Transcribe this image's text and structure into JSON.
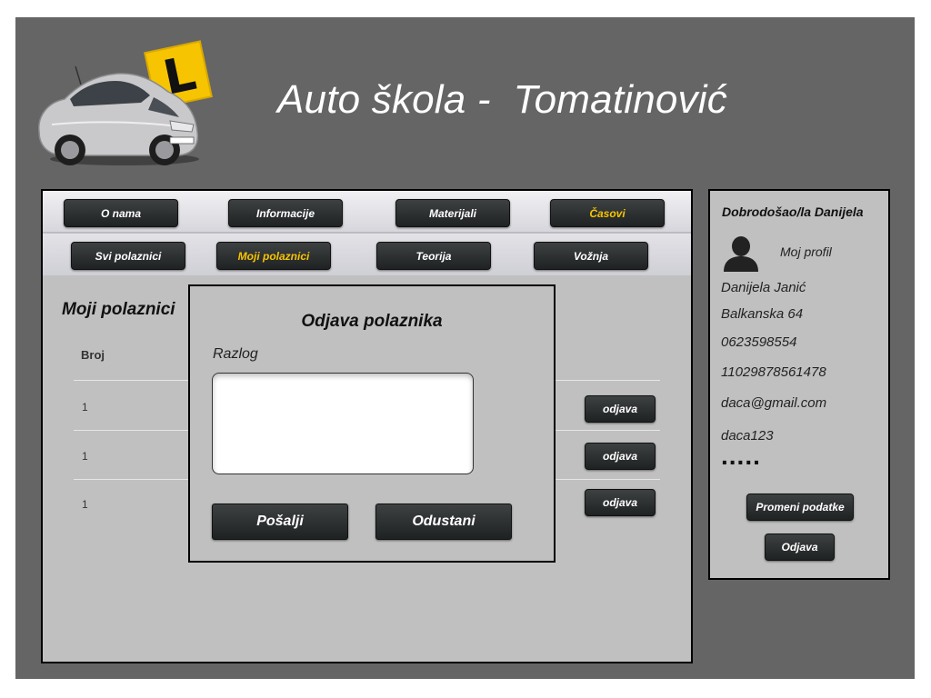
{
  "header": {
    "title": "Auto škola -  Tomatinović",
    "logo_plate": "L",
    "logo_icon": "car-with-l-sign-logo"
  },
  "nav": {
    "main": [
      {
        "label": "O nama",
        "active": false
      },
      {
        "label": "Informacije",
        "active": false
      },
      {
        "label": "Materijali",
        "active": false
      },
      {
        "label": "Časovi",
        "active": true
      }
    ],
    "sub": [
      {
        "label": "Svi polaznici",
        "active": false
      },
      {
        "label": "Moji polaznici",
        "active": true
      },
      {
        "label": "Teorija",
        "active": false
      },
      {
        "label": "Vožnja",
        "active": false
      }
    ]
  },
  "students": {
    "title": "Moji polaznici",
    "columns": [
      "Broj"
    ],
    "rows": [
      {
        "broj": "1",
        "action": "odjava"
      },
      {
        "broj": "1",
        "action": "odjava"
      },
      {
        "broj": "1",
        "action": "odjava"
      }
    ]
  },
  "modal": {
    "title": "Odjava polaznika",
    "reason_label": "Razlog",
    "reason_value": "",
    "submit_label": "Pošalji",
    "cancel_label": "Odustani"
  },
  "user": {
    "welcome": "Dobrodošao/la Danijela",
    "avatar_icon": "user-silhouette-icon",
    "profile_link": "Moj profil",
    "name": "Danijela Janić",
    "address": "Balkanska 64",
    "phone": "0623598554",
    "jmbg": "11029878561478",
    "email": "daca@gmail.com",
    "username": "daca123",
    "password_masked": ".....",
    "edit_label": "Promeni podatke",
    "logout_label": "Odjava"
  },
  "colors": {
    "page_bg": "#656565",
    "panel_bg": "#c0c0c0",
    "button_bg": "#2b2e2f",
    "active_text": "#f5c400",
    "title_text": "#ffffff"
  }
}
